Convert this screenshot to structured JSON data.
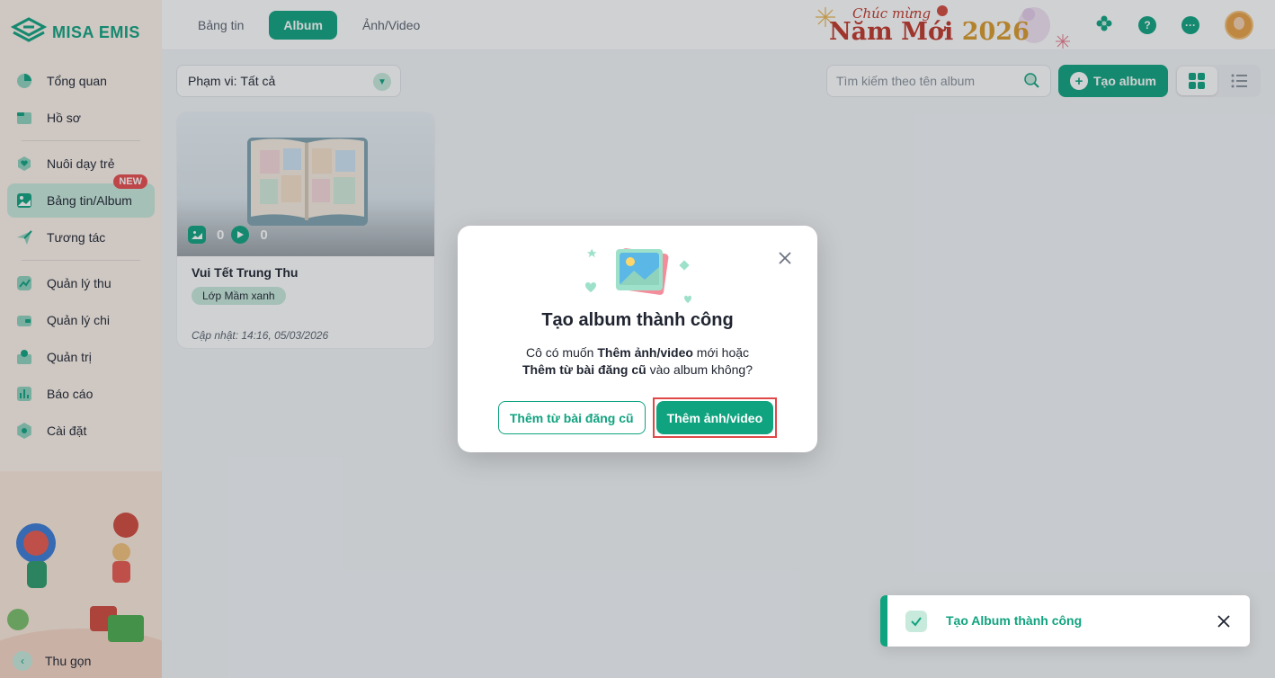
{
  "app": {
    "logo_text": "MISA EMIS",
    "accent_color": "#10a37f"
  },
  "sidebar": {
    "items": [
      {
        "label": "Tổng quan",
        "icon": "pie-chart-icon"
      },
      {
        "label": "Hồ sơ",
        "icon": "folder-icon"
      },
      {
        "label": "Nuôi dạy trẻ",
        "icon": "heart-hand-icon"
      },
      {
        "label": "Bảng tin/Album",
        "icon": "image-icon",
        "badge": "NEW",
        "active": true
      },
      {
        "label": "Tương tác",
        "icon": "paper-plane-icon"
      },
      {
        "label": "Quản lý thu",
        "icon": "trend-chart-icon"
      },
      {
        "label": "Quản lý chi",
        "icon": "wallet-icon"
      },
      {
        "label": "Quản trị",
        "icon": "admin-icon"
      },
      {
        "label": "Báo cáo",
        "icon": "bar-chart-icon"
      },
      {
        "label": "Cài đặt",
        "icon": "gear-icon"
      }
    ],
    "collapse_label": "Thu gọn"
  },
  "topbar": {
    "tabs": [
      {
        "label": "Bảng tin"
      },
      {
        "label": "Album",
        "active": true
      },
      {
        "label": "Ảnh/Video"
      }
    ],
    "greeting_small": "Chúc mừng",
    "greeting_big": "Năm Mới",
    "greeting_year": "2026",
    "help_icon_text": "?"
  },
  "toolbar": {
    "scope_label": "Phạm vi:",
    "scope_value": "Tất cả",
    "search_placeholder": "Tìm kiếm theo tên album",
    "create_label": "Tạo album"
  },
  "albums": [
    {
      "title": "Vui Tết Trung Thu",
      "class": "Lớp Mầm xanh",
      "photo_count": "0",
      "video_count": "0",
      "updated": "Cập nhật: 14:16, 05/03/2026"
    }
  ],
  "modal": {
    "title": "Tạo album thành công",
    "body_prefix": "Cô có muốn ",
    "body_bold_1": "Thêm ảnh/video",
    "body_middle": " mới hoặc",
    "body_bold_2": "Thêm từ bài đăng cũ",
    "body_suffix": " vào album không?",
    "secondary_label": "Thêm từ bài đăng cũ",
    "primary_label": "Thêm ảnh/video"
  },
  "toast": {
    "message": "Tạo Album thành công"
  }
}
